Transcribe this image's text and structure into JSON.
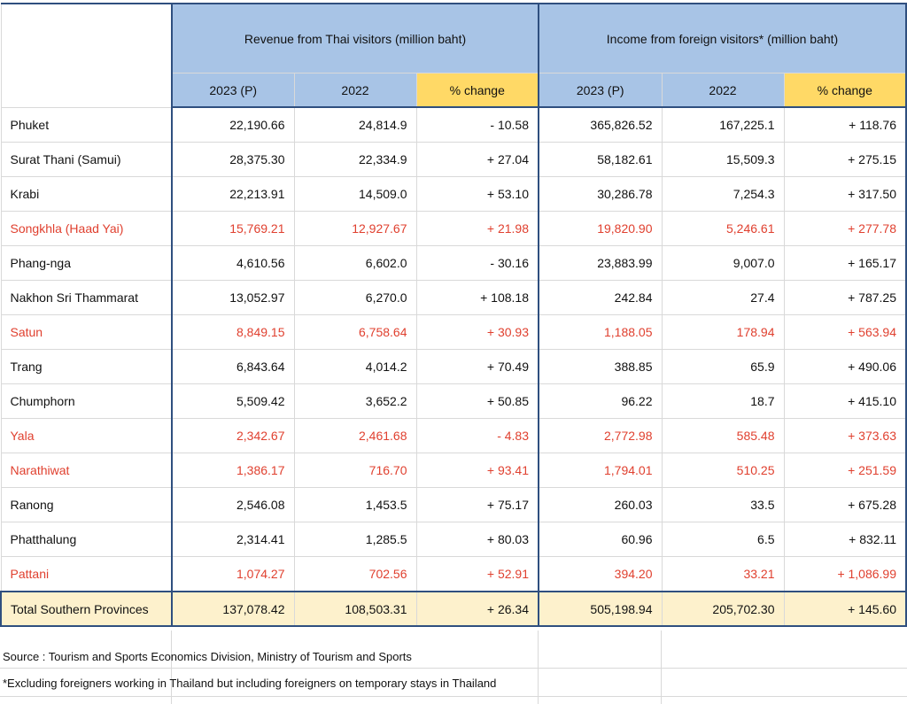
{
  "headers": {
    "group_thai": "Revenue from Thai visitors (million baht)",
    "group_foreign": "Income from foreign visitors* (million baht)",
    "sub": [
      "2023 (P)",
      "2022",
      "% change",
      "2023 (P)",
      "2022",
      "% change"
    ]
  },
  "rows": [
    {
      "name": "Phuket",
      "highlight": false,
      "vals": [
        "22,190.66",
        "24,814.9",
        "- 10.58",
        "365,826.52",
        "167,225.1",
        "+ 118.76"
      ]
    },
    {
      "name": "Surat Thani (Samui)",
      "highlight": false,
      "vals": [
        "28,375.30",
        "22,334.9",
        "+ 27.04",
        "58,182.61",
        "15,509.3",
        "+ 275.15"
      ]
    },
    {
      "name": "Krabi",
      "highlight": false,
      "vals": [
        "22,213.91",
        "14,509.0",
        "+ 53.10",
        "30,286.78",
        "7,254.3",
        "+ 317.50"
      ]
    },
    {
      "name": "Songkhla (Haad Yai)",
      "highlight": true,
      "vals": [
        "15,769.21",
        "12,927.67",
        "+ 21.98",
        "19,820.90",
        "5,246.61",
        "+ 277.78"
      ]
    },
    {
      "name": "Phang-nga",
      "highlight": false,
      "vals": [
        "4,610.56",
        "6,602.0",
        "- 30.16",
        "23,883.99",
        "9,007.0",
        "+ 165.17"
      ]
    },
    {
      "name": "Nakhon Sri Thammarat",
      "highlight": false,
      "vals": [
        "13,052.97",
        "6,270.0",
        "+ 108.18",
        "242.84",
        "27.4",
        "+ 787.25"
      ]
    },
    {
      "name": "Satun",
      "highlight": true,
      "vals": [
        "8,849.15",
        "6,758.64",
        "+ 30.93",
        "1,188.05",
        "178.94",
        "+ 563.94"
      ]
    },
    {
      "name": "Trang",
      "highlight": false,
      "vals": [
        "6,843.64",
        "4,014.2",
        "+ 70.49",
        "388.85",
        "65.9",
        "+ 490.06"
      ]
    },
    {
      "name": "Chumphorn",
      "highlight": false,
      "vals": [
        "5,509.42",
        "3,652.2",
        "+ 50.85",
        "96.22",
        "18.7",
        "+ 415.10"
      ]
    },
    {
      "name": "Yala",
      "highlight": true,
      "vals": [
        "2,342.67",
        "2,461.68",
        "- 4.83",
        "2,772.98",
        "585.48",
        "+ 373.63"
      ]
    },
    {
      "name": "Narathiwat",
      "highlight": true,
      "vals": [
        "1,386.17",
        "716.70",
        "+ 93.41",
        "1,794.01",
        "510.25",
        "+ 251.59"
      ]
    },
    {
      "name": "Ranong",
      "highlight": false,
      "vals": [
        "2,546.08",
        "1,453.5",
        "+ 75.17",
        "260.03",
        "33.5",
        "+ 675.28"
      ]
    },
    {
      "name": "Phatthalung",
      "highlight": false,
      "vals": [
        "2,314.41",
        "1,285.5",
        "+ 80.03",
        "60.96",
        "6.5",
        "+ 832.11"
      ]
    },
    {
      "name": "Pattani",
      "highlight": true,
      "vals": [
        "1,074.27",
        "702.56",
        "+ 52.91",
        "394.20",
        "33.21",
        "+ 1,086.99"
      ]
    }
  ],
  "total": {
    "name": "Total Southern Provinces",
    "vals": [
      "137,078.42",
      "108,503.31",
      "+ 26.34",
      "505,198.94",
      "205,702.30",
      "+ 145.60"
    ]
  },
  "notes": {
    "source": "Source : Tourism and Sports Economics Division, Ministry of Tourism and Sports",
    "footnote": "*Excluding foreigners working in Thailand but including foreigners on temporary stays in Thailand"
  },
  "colors": {
    "header_blue": "#a8c4e6",
    "pct_yellow": "#ffd966",
    "total_bg": "#fdf1cc",
    "highlight_red": "#e0402f",
    "border_navy": "#2f4f7f"
  }
}
